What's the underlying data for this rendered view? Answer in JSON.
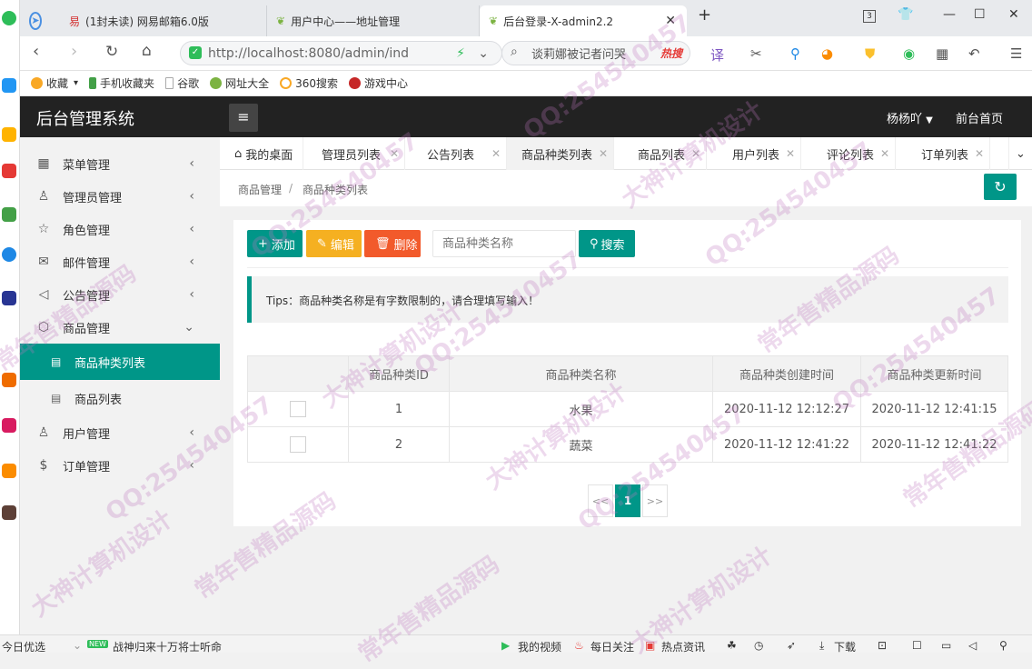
{
  "browser": {
    "tabs": [
      {
        "title": "(1封未读) 网易邮箱6.0版"
      },
      {
        "title": "用户中心——地址管理"
      },
      {
        "title": "后台登录-X-admin2.2"
      }
    ],
    "new_tab": "+",
    "tab_count": "3",
    "url": "http://localhost:8080/admin/ind",
    "search_placeholder": "谈莉娜被记者问哭",
    "hot_search": "热搜",
    "bookmarks": [
      "收藏",
      "手机收藏夹",
      "谷歌",
      "网址大全",
      "360搜索",
      "游戏中心"
    ]
  },
  "app": {
    "title": "后台管理系统",
    "menu_toggle": "≡",
    "user": "杨杨吖",
    "front_link": "前台首页"
  },
  "sidebar": {
    "items": [
      {
        "label": "菜单管理",
        "icon": "▦"
      },
      {
        "label": "管理员管理",
        "icon": "♙"
      },
      {
        "label": "角色管理",
        "icon": "☆"
      },
      {
        "label": "邮件管理",
        "icon": "✉"
      },
      {
        "label": "公告管理",
        "icon": "◁"
      },
      {
        "label": "商品管理",
        "icon": "⬡"
      }
    ],
    "sub_items": [
      {
        "label": "商品种类列表",
        "active": true
      },
      {
        "label": "商品列表",
        "active": false
      }
    ],
    "bottom_items": [
      {
        "label": "用户管理",
        "icon": "♙"
      },
      {
        "label": "订单管理",
        "icon": "$"
      }
    ]
  },
  "content_tabs": [
    "我的桌面",
    "管理员列表",
    "公告列表",
    "商品种类列表",
    "商品列表",
    "用户列表",
    "评论列表",
    "订单列表"
  ],
  "breadcrumb": [
    "商品管理",
    "商品种类列表"
  ],
  "breadcrumb_sep": "/",
  "toolbar": {
    "add": "添加",
    "edit": "编辑",
    "delete": "删除",
    "search_placeholder": "商品种类名称",
    "search": "搜索"
  },
  "tips": "Tips：商品种类名称是有字数限制的，请合理填写输入！",
  "table": {
    "headers": [
      "",
      "商品种类ID",
      "商品种类名称",
      "商品种类创建时间",
      "商品种类更新时间"
    ],
    "rows": [
      {
        "id": "1",
        "name": "水果",
        "created": "2020-11-12 12:12:27",
        "updated": "2020-11-12 12:41:15"
      },
      {
        "id": "2",
        "name": "蔬菜",
        "created": "2020-11-12 12:41:22",
        "updated": "2020-11-12 12:41:22"
      }
    ]
  },
  "pagination": {
    "prev": "<<",
    "current": "1",
    "next": ">>"
  },
  "statusbar": {
    "left": "今日优选",
    "news_badge": "NEW",
    "news": "战神归来十万将士听命",
    "items": [
      "我的视频",
      "每日关注",
      "热点资讯",
      "下载"
    ]
  },
  "watermarks": [
    "QQ:254540457",
    "大神计算机设计",
    "常年售精品源码"
  ],
  "colors": {
    "accent": "#009688",
    "edit": "#f5b021",
    "delete": "#f25a2b",
    "header": "#222222"
  }
}
